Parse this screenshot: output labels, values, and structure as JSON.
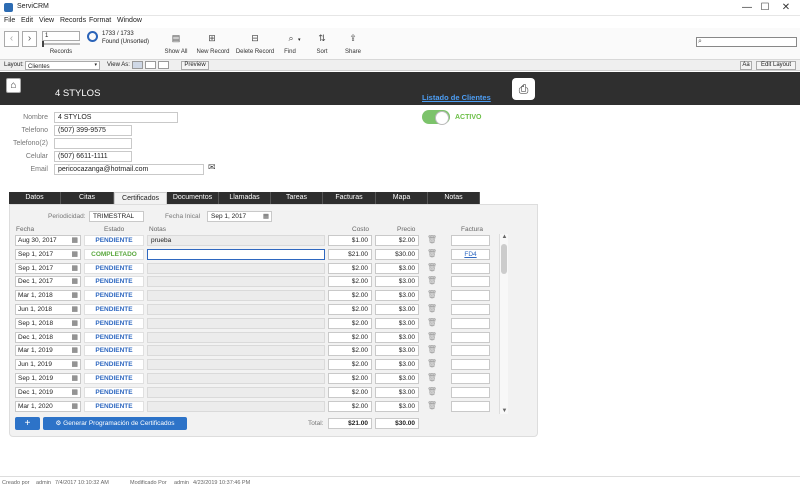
{
  "window": {
    "title": "ServiCRM",
    "minimize": "—",
    "maximize": "☐",
    "close": "✕"
  },
  "menu": [
    "File",
    "Edit",
    "View",
    "Records",
    "Format",
    "Window"
  ],
  "toolbar": {
    "record_value": "1",
    "records_label": "Records",
    "found_count": "1733 / 1733",
    "found_status": "Found (Unsorted)",
    "show_all": "Show All",
    "new_record": "New Record",
    "delete_record": "Delete Record",
    "find": "Find",
    "sort": "Sort",
    "share": "Share"
  },
  "layoutbar": {
    "layout_label": "Layout:",
    "layout_value": "Clientes",
    "view_as": "View As:",
    "preview": "Preview",
    "aa": "Aa",
    "edit_layout": "Edit Layout"
  },
  "header": {
    "name": "4 STYLOS",
    "link": "Listado de Clientes"
  },
  "contact": {
    "nombre_label": "Nombre",
    "nombre": "4 STYLOS",
    "telefono_label": "Telefono",
    "telefono": "(507) 399-9575",
    "telefono2_label": "Telefono(2)",
    "telefono2": "",
    "celular_label": "Celular",
    "celular": "(507) 6611-1111",
    "email_label": "Email",
    "email": "pericocazanga@hotmail.com"
  },
  "status": {
    "label": "ACTIVO",
    "on": true
  },
  "tabs": [
    "Datos",
    "Citas",
    "Certificados",
    "Documentos",
    "Llamadas",
    "Tareas",
    "Facturas",
    "Mapa",
    "Notas"
  ],
  "active_tab": "Certificados",
  "panel": {
    "periodicidad_label": "Periodicidad:",
    "periodicidad": "TRIMESTRAL",
    "fecha_inicial_label": "Fecha Inical",
    "fecha_inicial": "Sep 1, 2017",
    "columns": {
      "fecha": "Fecha",
      "estado": "Estado",
      "notas": "Notas",
      "costo": "Costo",
      "precio": "Precio",
      "factura": "Factura"
    },
    "rows": [
      {
        "fecha": "Aug 30, 2017",
        "estado": "PENDIENTE",
        "notas": "prueba",
        "costo": "$1.00",
        "precio": "$2.00",
        "factura": ""
      },
      {
        "fecha": "Sep 1, 2017",
        "estado": "COMPLETADO",
        "notas": "",
        "costo": "$21.00",
        "precio": "$30.00",
        "factura": "FD4"
      },
      {
        "fecha": "Sep 1, 2017",
        "estado": "PENDIENTE",
        "notas": "",
        "costo": "$2.00",
        "precio": "$3.00",
        "factura": ""
      },
      {
        "fecha": "Dec 1, 2017",
        "estado": "PENDIENTE",
        "notas": "",
        "costo": "$2.00",
        "precio": "$3.00",
        "factura": ""
      },
      {
        "fecha": "Mar 1, 2018",
        "estado": "PENDIENTE",
        "notas": "",
        "costo": "$2.00",
        "precio": "$3.00",
        "factura": ""
      },
      {
        "fecha": "Jun 1, 2018",
        "estado": "PENDIENTE",
        "notas": "",
        "costo": "$2.00",
        "precio": "$3.00",
        "factura": ""
      },
      {
        "fecha": "Sep 1, 2018",
        "estado": "PENDIENTE",
        "notas": "",
        "costo": "$2.00",
        "precio": "$3.00",
        "factura": ""
      },
      {
        "fecha": "Dec 1, 2018",
        "estado": "PENDIENTE",
        "notas": "",
        "costo": "$2.00",
        "precio": "$3.00",
        "factura": ""
      },
      {
        "fecha": "Mar 1, 2019",
        "estado": "PENDIENTE",
        "notas": "",
        "costo": "$2.00",
        "precio": "$3.00",
        "factura": ""
      },
      {
        "fecha": "Jun 1, 2019",
        "estado": "PENDIENTE",
        "notas": "",
        "costo": "$2.00",
        "precio": "$3.00",
        "factura": ""
      },
      {
        "fecha": "Sep 1, 2019",
        "estado": "PENDIENTE",
        "notas": "",
        "costo": "$2.00",
        "precio": "$3.00",
        "factura": ""
      },
      {
        "fecha": "Dec 1, 2019",
        "estado": "PENDIENTE",
        "notas": "",
        "costo": "$2.00",
        "precio": "$3.00",
        "factura": ""
      },
      {
        "fecha": "Mar 1, 2020",
        "estado": "PENDIENTE",
        "notas": "",
        "costo": "$2.00",
        "precio": "$3.00",
        "factura": ""
      }
    ],
    "add_label": "+",
    "generate_label": "Generar Programación de Certificados",
    "total_label": "Total:",
    "total_costo": "$21.00",
    "total_precio": "$30.00"
  },
  "footer": {
    "creado_label": "Creado por",
    "creado_user": "admin",
    "creado_date": "7/4/2017 10:10:32 AM",
    "modificado_label": "Modificado Por",
    "modificado_user": "admin",
    "modificado_date": "4/23/2019 10:37:46 PM"
  },
  "colors": {
    "accent": "#2d73c8",
    "header_bg": "#2f2f2f",
    "active_green": "#6cbf47",
    "link": "#4d9ef4"
  }
}
